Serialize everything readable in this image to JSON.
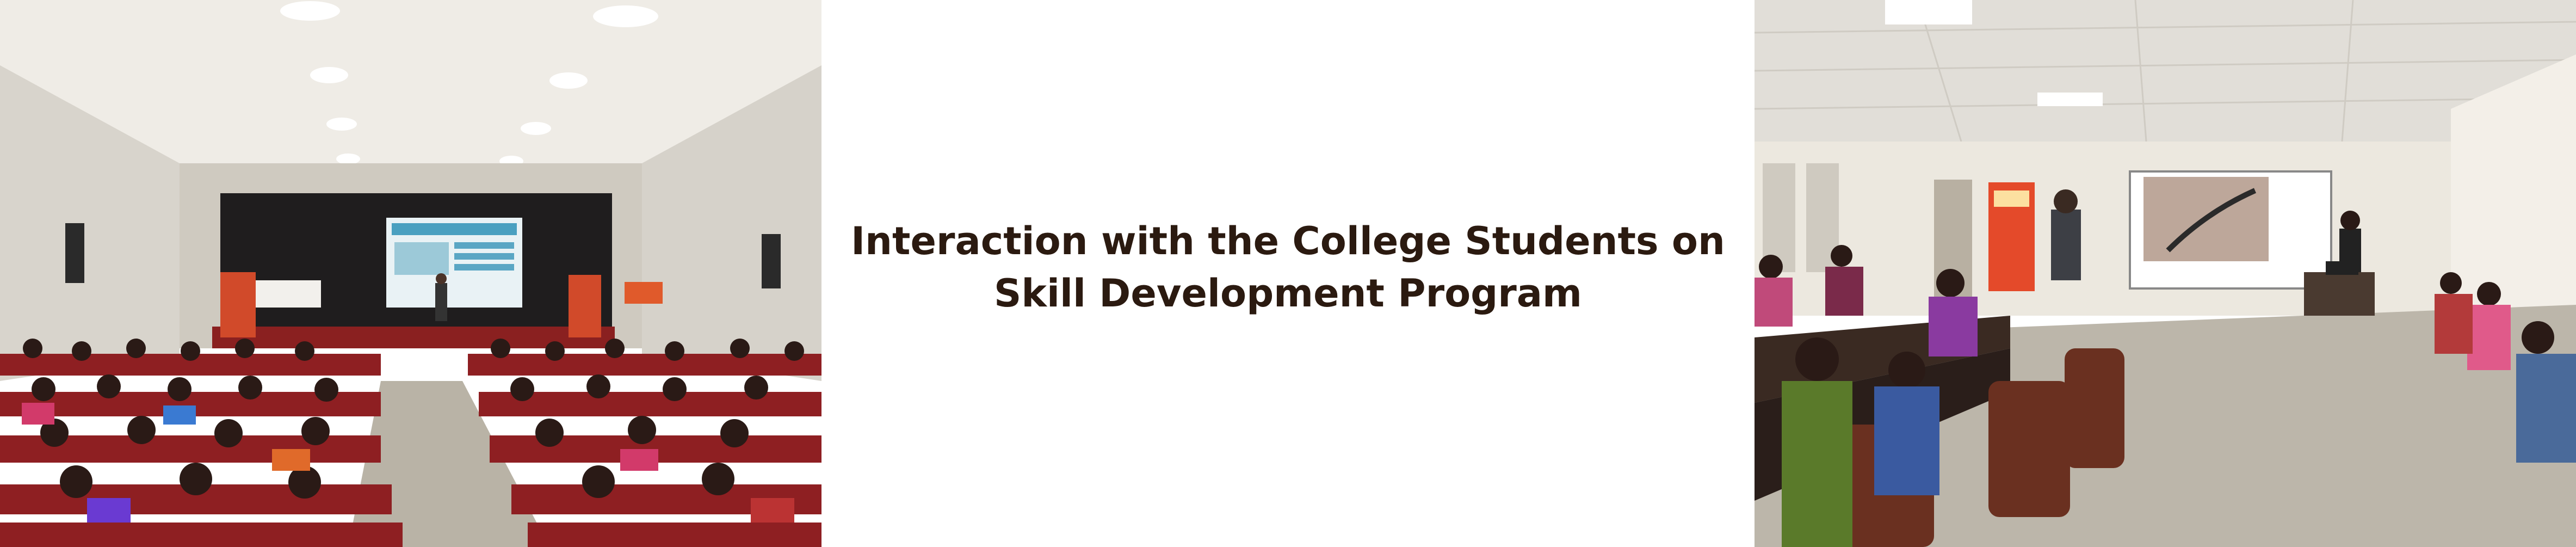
{
  "caption": {
    "line1": "Interaction with the College Students on",
    "line2": "Skill Development Program"
  },
  "photos": {
    "left": "auditorium-lecture-photo",
    "right": "classroom-session-photo"
  },
  "colors": {
    "caption_text": "#2b1a10",
    "background": "#ffffff",
    "seat_red": "#8e1f22",
    "ceiling": "#e8e6e0"
  }
}
